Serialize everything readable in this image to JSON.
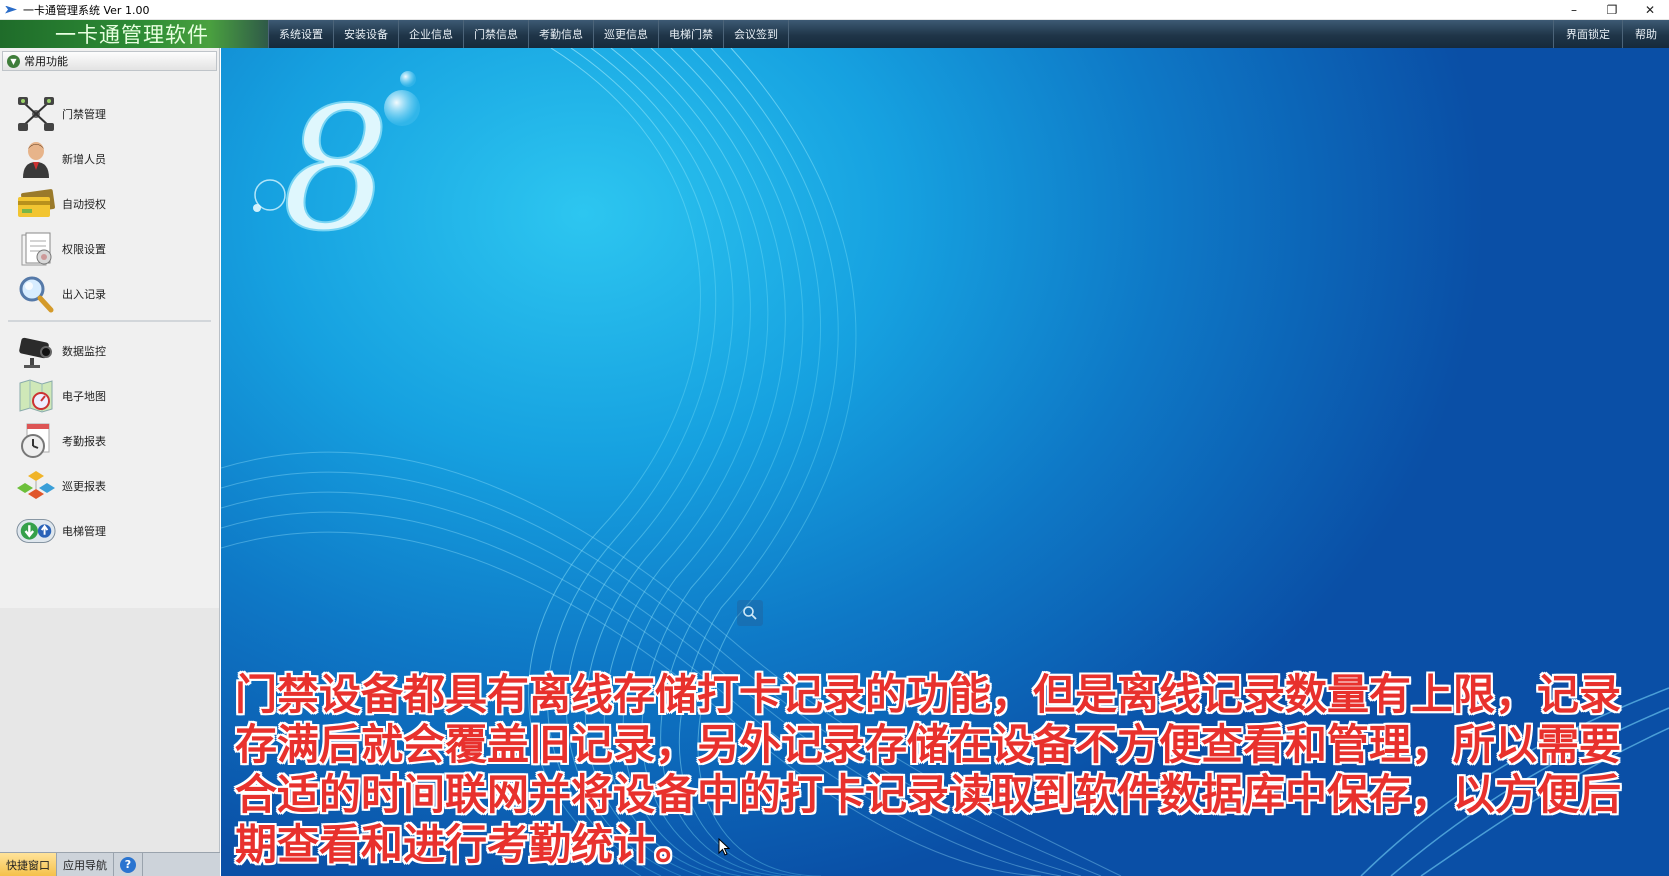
{
  "window": {
    "title": "一卡通管理系统  Ver 1.00",
    "minimize": "–",
    "restore": "❐",
    "close": "✕"
  },
  "menubar": {
    "brand": "一卡通管理软件",
    "items": [
      "系统设置",
      "安装设备",
      "企业信息",
      "门禁信息",
      "考勤信息",
      "巡更信息",
      "电梯门禁",
      "会议签到"
    ],
    "right_items": [
      "界面锁定",
      "帮助"
    ]
  },
  "sidebar": {
    "header": "常用功能",
    "group1": [
      {
        "label": "门禁管理",
        "icon": "network-cameras-icon"
      },
      {
        "label": "新增人员",
        "icon": "person-icon"
      },
      {
        "label": "自动授权",
        "icon": "card-icon"
      },
      {
        "label": "权限设置",
        "icon": "document-icon"
      },
      {
        "label": "出入记录",
        "icon": "magnifier-icon"
      }
    ],
    "group2": [
      {
        "label": "数据监控",
        "icon": "camera-icon"
      },
      {
        "label": "电子地图",
        "icon": "map-icon"
      },
      {
        "label": "考勤报表",
        "icon": "clock-icon"
      },
      {
        "label": "巡更报表",
        "icon": "cubes-icon"
      },
      {
        "label": "电梯管理",
        "icon": "elevator-arrows-icon"
      }
    ]
  },
  "bottom_tabs": {
    "quick": "快捷窗口",
    "nav": "应用导航",
    "help": "?"
  },
  "main": {
    "logo_digit": "8",
    "caption": "门禁设备都具有离线存储打卡记录的功能，但是离线记录数量有上限，记录存满后就会覆盖旧记录，另外记录存储在设备不方便查看和管理，所以需要合适的时间联网并将设备中的打卡记录读取到软件数据库中保存，以方便后期查看和进行考勤统计。"
  },
  "colors": {
    "brand_green": "#2e8d35",
    "menubar_dark": "#1f3548",
    "caption_red": "#e8312d",
    "desktop_blue": "#16a1e0"
  }
}
